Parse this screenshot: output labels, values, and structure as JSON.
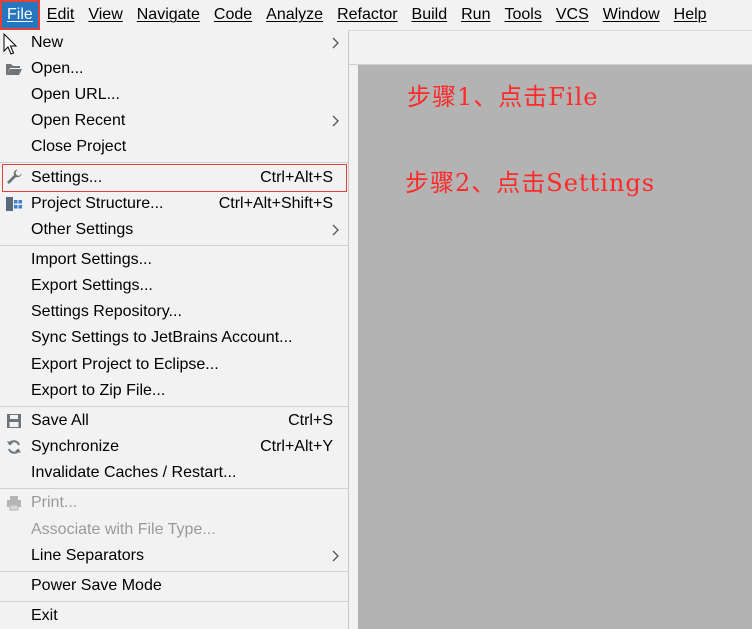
{
  "menubar": {
    "items": [
      {
        "label": "File"
      },
      {
        "label": "Edit"
      },
      {
        "label": "View"
      },
      {
        "label": "Navigate"
      },
      {
        "label": "Code"
      },
      {
        "label": "Analyze"
      },
      {
        "label": "Refactor"
      },
      {
        "label": "Build"
      },
      {
        "label": "Run"
      },
      {
        "label": "Tools"
      },
      {
        "label": "VCS"
      },
      {
        "label": "Window"
      },
      {
        "label": "Help"
      }
    ]
  },
  "file_menu": {
    "items": [
      {
        "label": "New",
        "submenu": true
      },
      {
        "label": "Open...",
        "icon": "folder-open-icon"
      },
      {
        "label": "Open URL..."
      },
      {
        "label": "Open Recent",
        "submenu": true
      },
      {
        "label": "Close Project"
      },
      {
        "label": "Settings...",
        "shortcut": "Ctrl+Alt+S",
        "icon": "wrench-icon"
      },
      {
        "label": "Project Structure...",
        "shortcut": "Ctrl+Alt+Shift+S",
        "icon": "project-structure-icon"
      },
      {
        "label": "Other Settings",
        "submenu": true
      },
      {
        "label": "Import Settings..."
      },
      {
        "label": "Export Settings..."
      },
      {
        "label": "Settings Repository..."
      },
      {
        "label": "Sync Settings to JetBrains Account..."
      },
      {
        "label": "Export Project to Eclipse..."
      },
      {
        "label": "Export to Zip File..."
      },
      {
        "label": "Save All",
        "shortcut": "Ctrl+S",
        "icon": "save-icon"
      },
      {
        "label": "Synchronize",
        "shortcut": "Ctrl+Alt+Y",
        "icon": "sync-icon"
      },
      {
        "label": "Invalidate Caches / Restart..."
      },
      {
        "label": "Print...",
        "icon": "printer-icon",
        "disabled": true
      },
      {
        "label": "Associate with File Type...",
        "disabled": true
      },
      {
        "label": "Line Separators",
        "submenu": true
      },
      {
        "label": "Power Save Mode"
      },
      {
        "label": "Exit"
      }
    ]
  },
  "annotations": {
    "step1": "步骤1、点击File",
    "step2": "步骤2、点击Settings"
  },
  "colors": {
    "menubar_active_bg": "#2675bf",
    "highlight_border": "#e0423a",
    "annotation_text": "#ff2a2a",
    "editor_bg": "#b3b3b3"
  }
}
